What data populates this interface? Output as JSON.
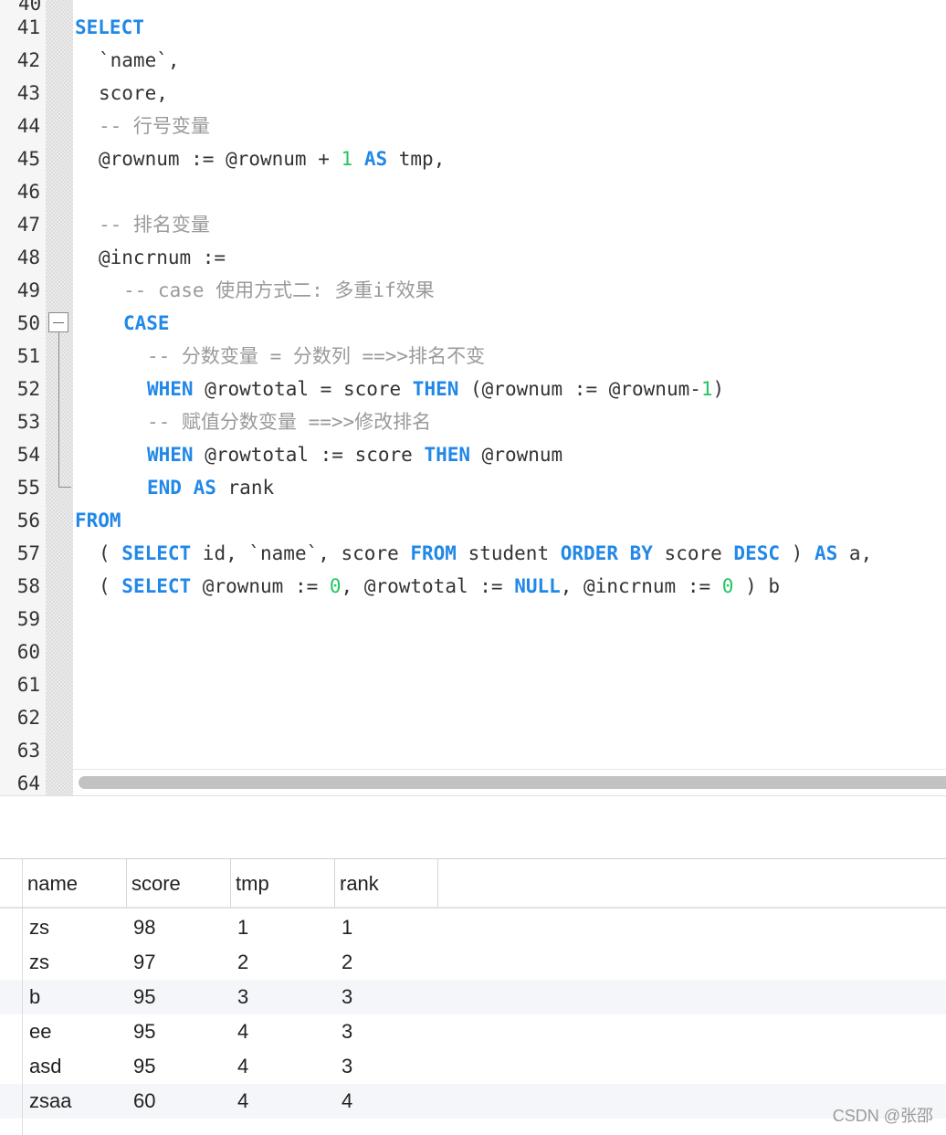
{
  "editor": {
    "lines": [
      {
        "n": "41",
        "html": "<span class='kw'>SELECT</span>"
      },
      {
        "n": "42",
        "html": "<span class='i1'>`name`,</span>"
      },
      {
        "n": "43",
        "html": "<span class='i1'>score,</span>"
      },
      {
        "n": "44",
        "html": "<span class='i1 cmt'>-- 行号变量</span>"
      },
      {
        "n": "45",
        "html": "<span class='i1'>@rownum := @rownum + <span class='num'>1</span> <span class='kw'>AS</span> tmp,</span>"
      },
      {
        "n": "46",
        "html": ""
      },
      {
        "n": "47",
        "html": "<span class='i1 cmt'>-- 排名变量</span>"
      },
      {
        "n": "48",
        "html": "<span class='i1'>@incrnum :=</span>"
      },
      {
        "n": "49",
        "html": "<span class='i2 cmt'>-- case 使用方式二: 多重if效果</span>"
      },
      {
        "n": "50",
        "html": "<span class='i2 kw'>CASE</span>"
      },
      {
        "n": "51",
        "html": "<span class='i3 cmt'>-- 分数变量 = 分数列 ==>>排名不变</span>"
      },
      {
        "n": "52",
        "html": "<span class='i3'><span class='kw'>WHEN</span> @rowtotal = score <span class='kw'>THEN</span> (@rownum := @rownum-<span class='num'>1</span>)</span>"
      },
      {
        "n": "53",
        "html": "<span class='i3 cmt'>-- 赋值分数变量 ==>>修改排名</span>"
      },
      {
        "n": "54",
        "html": "<span class='i3'><span class='kw'>WHEN</span> @rowtotal := score <span class='kw'>THEN</span> @rownum</span>"
      },
      {
        "n": "55",
        "html": "<span class='i3'><span class='kw'>END</span> <span class='kw'>AS</span> rank</span>"
      },
      {
        "n": "56",
        "html": "<span class='kw'>FROM</span>"
      },
      {
        "n": "57",
        "html": "<span class='i1'>( <span class='kw'>SELECT</span> id, `name`, score <span class='kw'>FROM</span> student <span class='kw'>ORDER BY</span> score <span class='kw'>DESC</span> ) <span class='kw'>AS</span> a,</span>"
      },
      {
        "n": "58",
        "html": "<span class='i1'>( <span class='kw'>SELECT</span> @rownum := <span class='num'>0</span>, @rowtotal := <span class='kw'>NULL</span>, @incrnum := <span class='num'>0</span> ) b</span>"
      },
      {
        "n": "59",
        "html": ""
      },
      {
        "n": "60",
        "html": ""
      },
      {
        "n": "61",
        "html": ""
      },
      {
        "n": "62",
        "html": ""
      },
      {
        "n": "63",
        "html": ""
      },
      {
        "n": "64",
        "html": ""
      }
    ]
  },
  "results": {
    "columns": [
      "name",
      "score",
      "tmp",
      "rank"
    ],
    "rows": [
      [
        "zs",
        "98",
        "1",
        "1"
      ],
      [
        "zs",
        "97",
        "2",
        "2"
      ],
      [
        "b",
        "95",
        "3",
        "3"
      ],
      [
        "ee",
        "95",
        "4",
        "3"
      ],
      [
        "asd",
        "95",
        "4",
        "3"
      ],
      [
        "zsaa",
        "60",
        "4",
        "4"
      ]
    ]
  },
  "watermark": "CSDN @张邵",
  "colors": {
    "keyword": "#2188e8",
    "number": "#22c55e",
    "comment": "#9a9a9a"
  }
}
